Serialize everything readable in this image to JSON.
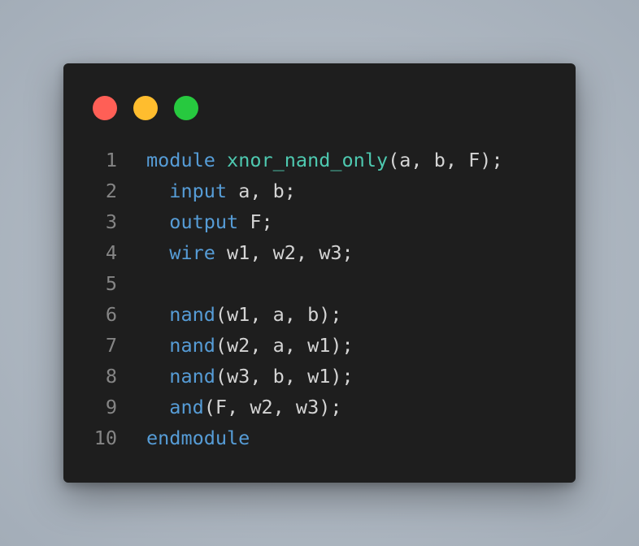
{
  "window": {
    "controls": [
      {
        "name": "close",
        "color": "#ff5f56"
      },
      {
        "name": "minimize",
        "color": "#ffbd2e"
      },
      {
        "name": "maximize",
        "color": "#27c93f"
      }
    ]
  },
  "code": {
    "language": "verilog",
    "lines": [
      {
        "number": "1",
        "tokens": [
          {
            "text": "module",
            "kind": "keyword"
          },
          {
            "text": " ",
            "kind": "plain"
          },
          {
            "text": "xnor_nand_only",
            "kind": "module"
          },
          {
            "text": "(a, b, F);",
            "kind": "plain"
          }
        ]
      },
      {
        "number": "2",
        "tokens": [
          {
            "text": "  ",
            "kind": "plain"
          },
          {
            "text": "input",
            "kind": "keyword"
          },
          {
            "text": " a, b;",
            "kind": "plain"
          }
        ]
      },
      {
        "number": "3",
        "tokens": [
          {
            "text": "  ",
            "kind": "plain"
          },
          {
            "text": "output",
            "kind": "keyword"
          },
          {
            "text": " F;",
            "kind": "plain"
          }
        ]
      },
      {
        "number": "4",
        "tokens": [
          {
            "text": "  ",
            "kind": "plain"
          },
          {
            "text": "wire",
            "kind": "keyword"
          },
          {
            "text": " w1, w2, w3;",
            "kind": "plain"
          }
        ]
      },
      {
        "number": "5",
        "tokens": []
      },
      {
        "number": "6",
        "tokens": [
          {
            "text": "  ",
            "kind": "plain"
          },
          {
            "text": "nand",
            "kind": "keyword"
          },
          {
            "text": "(w1, a, b);",
            "kind": "plain"
          }
        ]
      },
      {
        "number": "7",
        "tokens": [
          {
            "text": "  ",
            "kind": "plain"
          },
          {
            "text": "nand",
            "kind": "keyword"
          },
          {
            "text": "(w2, a, w1);",
            "kind": "plain"
          }
        ]
      },
      {
        "number": "8",
        "tokens": [
          {
            "text": "  ",
            "kind": "plain"
          },
          {
            "text": "nand",
            "kind": "keyword"
          },
          {
            "text": "(w3, b, w1);",
            "kind": "plain"
          }
        ]
      },
      {
        "number": "9",
        "tokens": [
          {
            "text": "  ",
            "kind": "plain"
          },
          {
            "text": "and",
            "kind": "keyword"
          },
          {
            "text": "(F, w2, w3);",
            "kind": "plain"
          }
        ]
      },
      {
        "number": "10",
        "tokens": [
          {
            "text": "endmodule",
            "kind": "keyword"
          }
        ]
      }
    ]
  },
  "colors": {
    "background": "#1e1e1e",
    "keyword": "#569cd6",
    "module_name": "#4ec9b0",
    "text": "#d4d4d4",
    "line_number": "#858585"
  }
}
